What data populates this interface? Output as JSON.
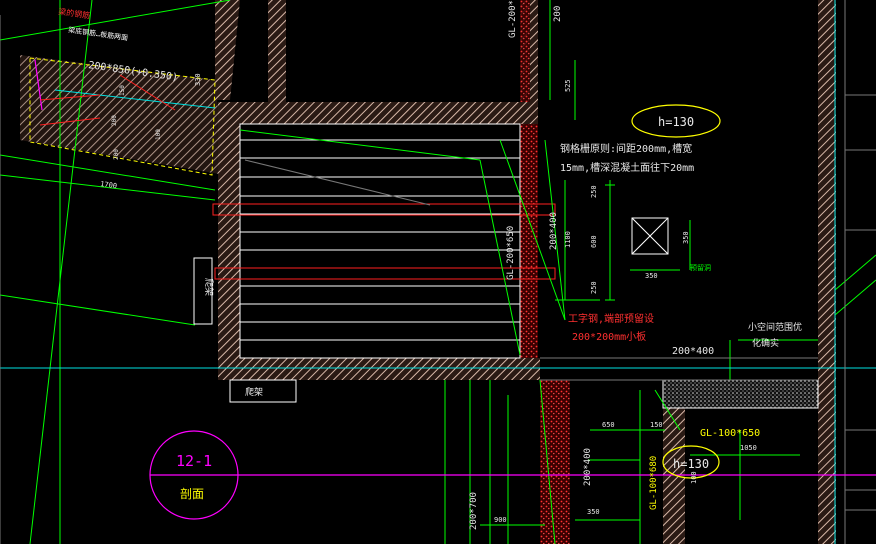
{
  "colors": {
    "background": "#000000",
    "wall": "#e8c8b8",
    "wall_hatch": "#c0a090",
    "dim_green": "#00ff00",
    "dim_text": "#e8e8e8",
    "yellow": "#ffff00",
    "red": "#ff2020",
    "magenta": "#ff00ff",
    "cyan": "#00e0e0",
    "blue": "#2040ff"
  },
  "labels": {
    "top_left_red_1": "梁的钢筋",
    "top_left_red_2": "梁底钢筋…板筋两面",
    "beam_left": "200*850(+0.350)",
    "dim_left_1700": "1700",
    "dim_left_330": "330",
    "dim_left_150": "150",
    "dim_left_200": "200",
    "dim_left_100": "100",
    "dim_left_200b": "200",
    "dim_left_130": "130",
    "gl_top": "GL-200*",
    "dim_top_200": "200",
    "dim_525": "525",
    "h_top": "h=130",
    "note_line1": "钢格栅原则:间距200mm,槽宽",
    "note_line2": "15mm,槽深混凝土面往下20mm",
    "dim_200x400_v": "200*400",
    "gl_mid": "GL-200*650",
    "dim_1100": "1100",
    "dim_250a": "250",
    "dim_600": "600",
    "dim_250b": "250",
    "dim_350h": "350",
    "dim_350v": "350",
    "small_label_green": "预留洞",
    "red_note_1": "工字钢,端部预留设",
    "red_note_2": "200*200mm小板",
    "left_vertical_label": "爬架",
    "bottom_box_label": "爬架",
    "circle_top": "12-1",
    "circle_bottom": "剖面",
    "dim_200x400_h": "200*400",
    "right_note_1": "小空间范围优",
    "right_note_2": "化确实",
    "dim_650": "650",
    "dim_150": "150",
    "gl_small": "GL-100*650",
    "h_bottom": "h=130",
    "dim_1050": "1050",
    "dim_100x680": "GL-100*680",
    "dim_200x400_v2": "200*400",
    "dim_200x700": "200*700",
    "dim_900": "900",
    "dim_350b": "350",
    "dim_100": "100"
  }
}
